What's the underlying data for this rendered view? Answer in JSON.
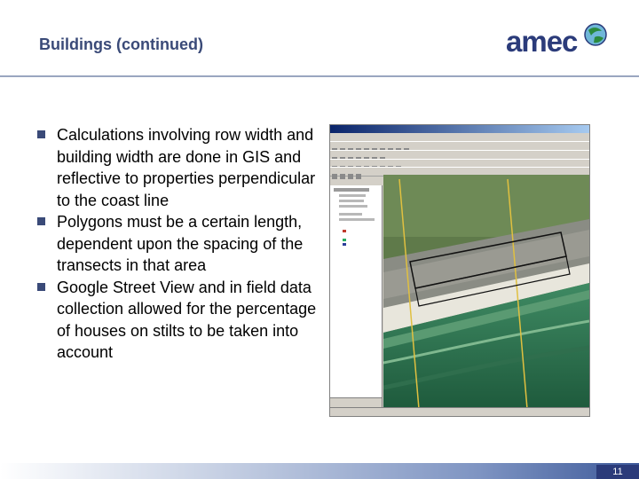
{
  "slide": {
    "title": "Buildings (continued)",
    "page_number": "11"
  },
  "logo": {
    "text": "amec"
  },
  "bullets": [
    "Calculations involving row width and building width are done in GIS and reflective to properties perpendicular to the coast line",
    "Polygons must be a certain length, dependent upon the spacing of the transects in that area",
    "Google Street View and in field data collection allowed for the percentage of houses on stilts to be taken into account"
  ],
  "colors": {
    "title": "#3a4a78",
    "logo": "#2b3b7a",
    "accent_bar": "#2b3b7a"
  },
  "icons": {
    "bullet": "square-bullet-icon",
    "logo_mark": "globe-icon"
  }
}
